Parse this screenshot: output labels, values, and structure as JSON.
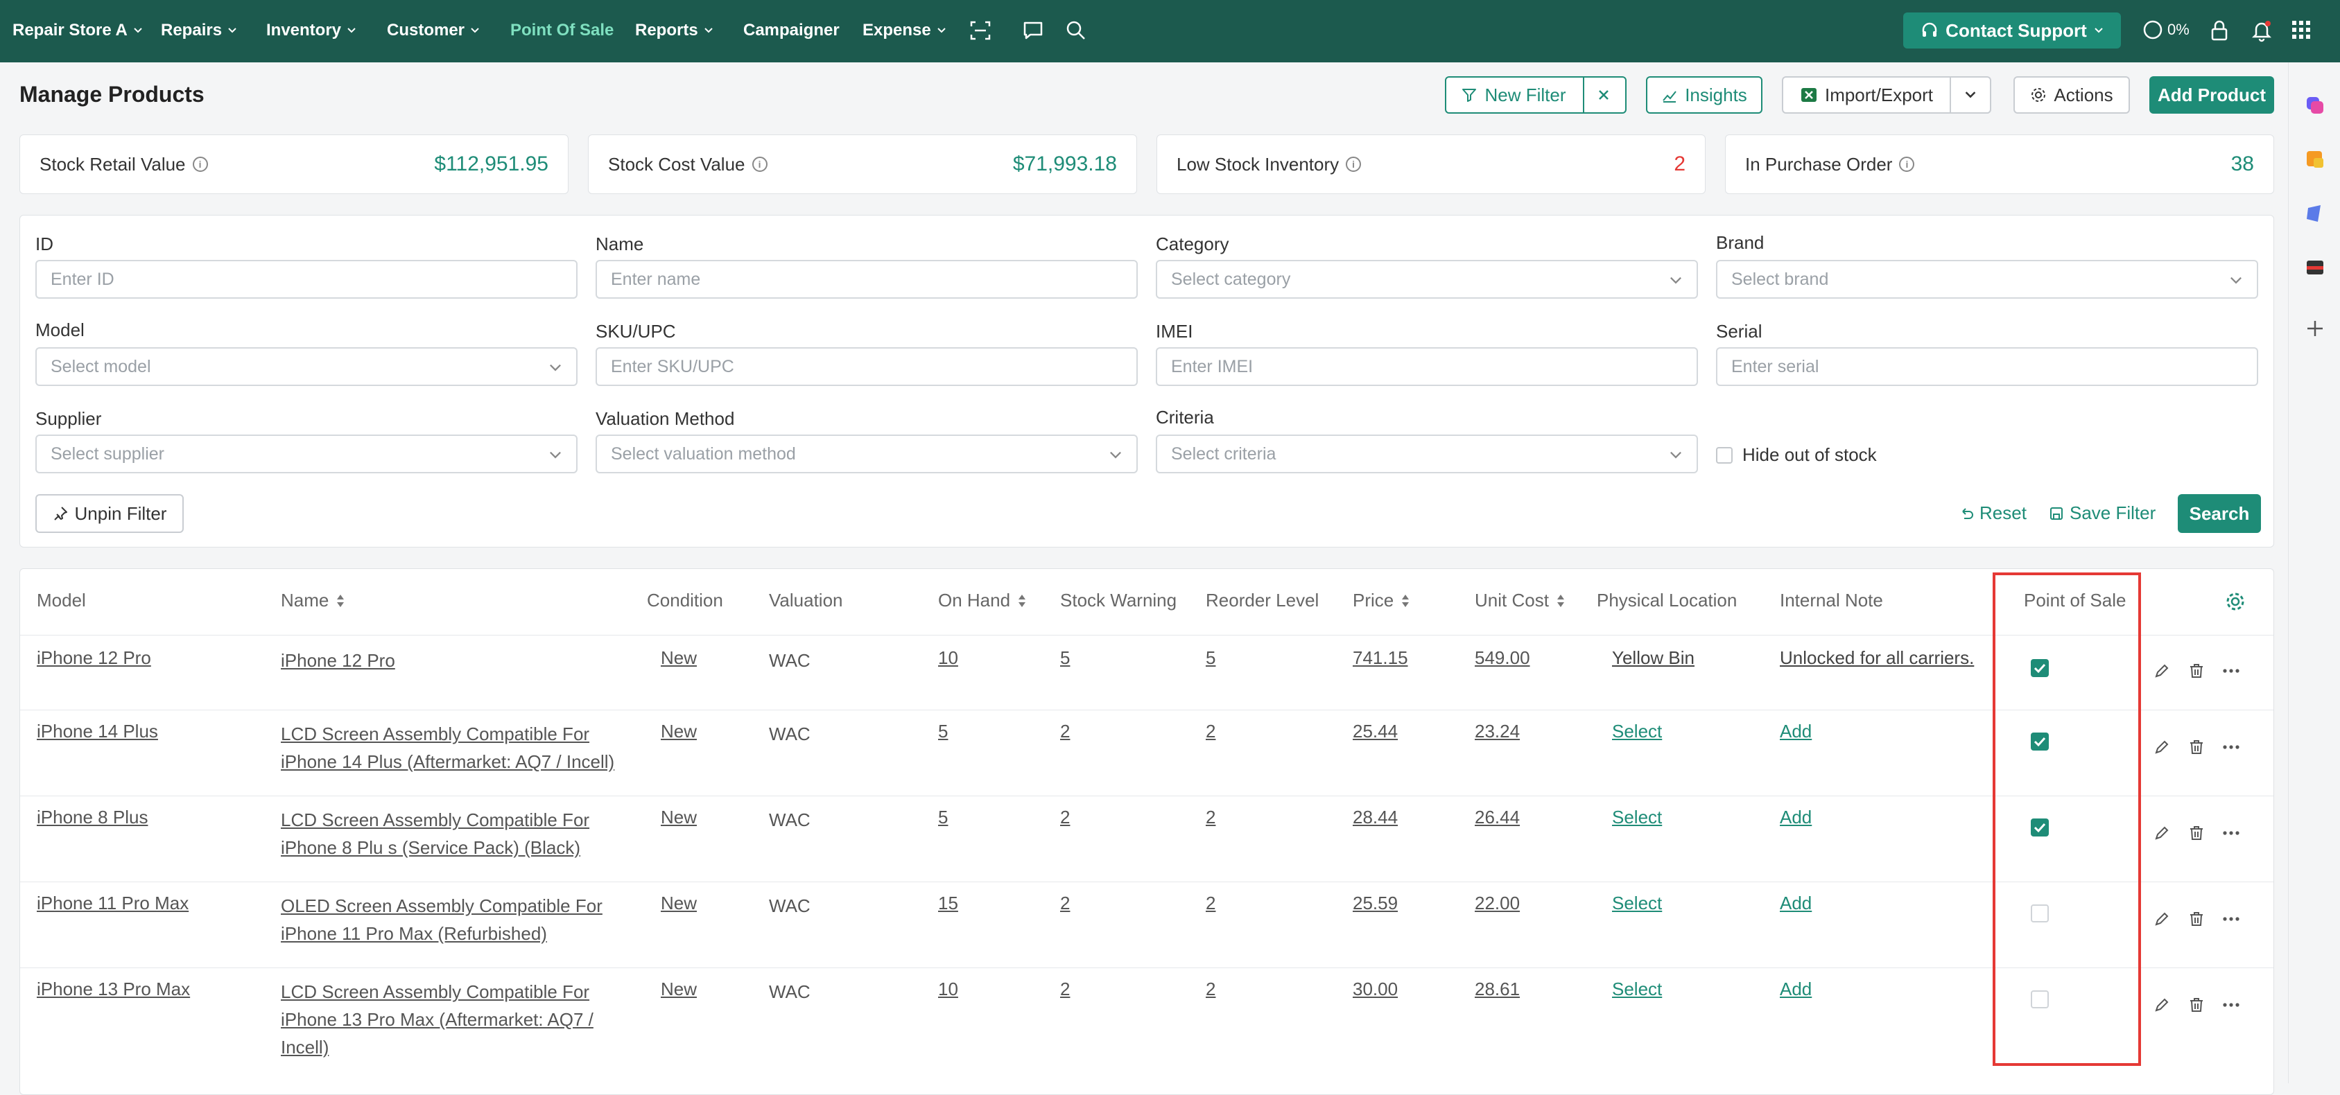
{
  "nav": {
    "store": "Repair Store A",
    "items": [
      {
        "label": "Repairs"
      },
      {
        "label": "Inventory"
      },
      {
        "label": "Customer"
      },
      {
        "label": "Point Of Sale"
      },
      {
        "label": "Reports"
      },
      {
        "label": "Campaigner"
      },
      {
        "label": "Expense"
      }
    ],
    "contact_support": "Contact Support",
    "percent": "0%"
  },
  "header": {
    "title": "Manage Products",
    "new_filter": "New Filter",
    "insights": "Insights",
    "import_export": "Import/Export",
    "actions": "Actions",
    "add_product": "Add Product"
  },
  "stats": [
    {
      "label": "Stock Retail Value",
      "value": "$112,951.95"
    },
    {
      "label": "Stock Cost Value",
      "value": "$71,993.18"
    },
    {
      "label": "Low Stock Inventory",
      "value": "2"
    },
    {
      "label": "In Purchase Order",
      "value": "38"
    }
  ],
  "filters": {
    "id": {
      "label": "ID",
      "placeholder": "Enter ID"
    },
    "name": {
      "label": "Name",
      "placeholder": "Enter name"
    },
    "category": {
      "label": "Category",
      "placeholder": "Select category"
    },
    "brand": {
      "label": "Brand",
      "placeholder": "Select brand"
    },
    "model": {
      "label": "Model",
      "placeholder": "Select model"
    },
    "sku": {
      "label": "SKU/UPC",
      "placeholder": "Enter SKU/UPC"
    },
    "imei": {
      "label": "IMEI",
      "placeholder": "Enter IMEI"
    },
    "serial": {
      "label": "Serial",
      "placeholder": "Enter serial"
    },
    "supplier": {
      "label": "Supplier",
      "placeholder": "Select supplier"
    },
    "valuation": {
      "label": "Valuation Method",
      "placeholder": "Select valuation method"
    },
    "criteria": {
      "label": "Criteria",
      "placeholder": "Select criteria"
    },
    "hide_oos": "Hide out of stock",
    "unpin": "Unpin Filter",
    "reset": "Reset",
    "save_filter": "Save Filter",
    "search": "Search"
  },
  "table": {
    "columns": {
      "model": "Model",
      "name": "Name",
      "condition": "Condition",
      "valuation": "Valuation",
      "on_hand": "On Hand",
      "stock_warning": "Stock Warning",
      "reorder_level": "Reorder Level",
      "price": "Price",
      "unit_cost": "Unit Cost",
      "physical_location": "Physical Location",
      "internal_note": "Internal Note",
      "point_of_sale": "Point of Sale"
    },
    "rows": [
      {
        "model": "iPhone 12 Pro",
        "name1": "iPhone 12 Pro",
        "name2": "",
        "name3": "",
        "condition": "New",
        "valuation": "WAC",
        "on_hand": "10",
        "stock_warning": "5",
        "reorder_level": "5",
        "price": "741.15",
        "unit_cost": "549.00",
        "location": "Yellow Bin",
        "note": "Unlocked for all carriers.",
        "pos": true
      },
      {
        "model": "iPhone 14 Plus",
        "name1": "LCD Screen Assembly Compatible For",
        "name2": "iPhone 14 Plus (Aftermarket: AQ7 / Incell)",
        "name3": "",
        "condition": "New",
        "valuation": "WAC",
        "on_hand": "5",
        "stock_warning": "2",
        "reorder_level": "2",
        "price": "25.44",
        "unit_cost": "23.24",
        "location": "Select",
        "note": "Add",
        "pos": true
      },
      {
        "model": "iPhone 8 Plus",
        "name1": "LCD Screen Assembly Compatible For",
        "name2": "iPhone 8 Plu s (Service Pack) (Black)",
        "name3": "",
        "condition": "New",
        "valuation": "WAC",
        "on_hand": "5",
        "stock_warning": "2",
        "reorder_level": "2",
        "price": "28.44",
        "unit_cost": "26.44",
        "location": "Select",
        "note": "Add",
        "pos": true
      },
      {
        "model": "iPhone 11 Pro Max",
        "name1": "OLED Screen Assembly Compatible For",
        "name2": "iPhone 11 Pro Max (Refurbished)",
        "name3": "",
        "condition": "New",
        "valuation": "WAC",
        "on_hand": "15",
        "stock_warning": "2",
        "reorder_level": "2",
        "price": "25.59",
        "unit_cost": "22.00",
        "location": "Select",
        "note": "Add",
        "pos": false
      },
      {
        "model": "iPhone 13 Pro Max",
        "name1": "LCD Screen Assembly Compatible For",
        "name2": "iPhone 13 Pro Max (Aftermarket: AQ7 /",
        "name3": "Incell)",
        "condition": "New",
        "valuation": "WAC",
        "on_hand": "10",
        "stock_warning": "2",
        "reorder_level": "2",
        "price": "30.00",
        "unit_cost": "28.61",
        "location": "Select",
        "note": "Add",
        "pos": false
      }
    ]
  }
}
